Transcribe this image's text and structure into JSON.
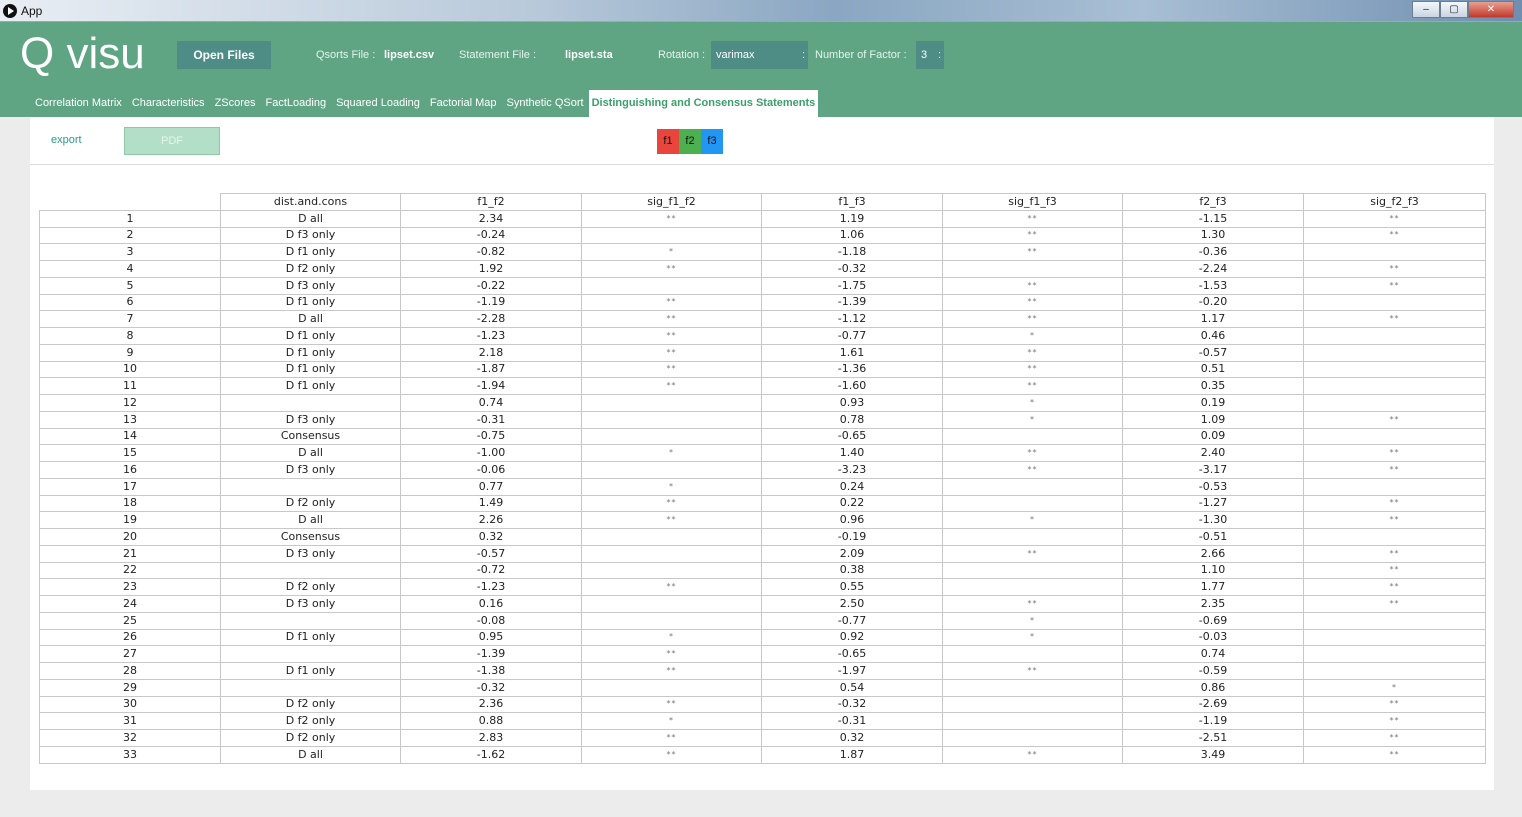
{
  "window": {
    "title": "App",
    "buttons": [
      "–",
      "▢",
      "✕"
    ]
  },
  "header": {
    "logo": "Q visu",
    "open_files": "Open Files",
    "qsorts_label": "Qsorts File :",
    "qsorts_value": "lipset.csv",
    "statement_label": "Statement File :",
    "statement_value": "lipset.sta",
    "rotation_label": "Rotation :",
    "rotation_value": "varimax",
    "nfactor_label": "Number of Factor :",
    "nfactor_value": "3",
    "select_arrow": ":"
  },
  "tabs": [
    "Correlation Matrix",
    "Characteristics",
    "ZScores",
    "FactLoading",
    "Squared Loading",
    "Factorial Map",
    "Synthetic QSort",
    "Distinguishing and Consensus Statements"
  ],
  "active_tab": 7,
  "toolbar": {
    "export": "export",
    "pdf": "PDF",
    "factors": [
      {
        "label": "f1",
        "color": "#e8453c"
      },
      {
        "label": "f2",
        "color": "#4caf50"
      },
      {
        "label": "f3",
        "color": "#2196f3"
      }
    ]
  },
  "table": {
    "columns": [
      "",
      "dist.and.cons",
      "f1_f2",
      "sig_f1_f2",
      "f1_f3",
      "sig_f1_f3",
      "f2_f3",
      "sig_f2_f3"
    ],
    "rows": [
      [
        "1",
        "D all",
        "2.34",
        "**",
        "1.19",
        "**",
        "-1.15",
        "**"
      ],
      [
        "2",
        "D f3 only",
        "-0.24",
        "",
        "1.06",
        "**",
        "1.30",
        "**"
      ],
      [
        "3",
        "D f1 only",
        "-0.82",
        "*",
        "-1.18",
        "**",
        "-0.36",
        ""
      ],
      [
        "4",
        "D f2 only",
        "1.92",
        "**",
        "-0.32",
        "",
        "-2.24",
        "**"
      ],
      [
        "5",
        "D f3 only",
        "-0.22",
        "",
        "-1.75",
        "**",
        "-1.53",
        "**"
      ],
      [
        "6",
        "D f1 only",
        "-1.19",
        "**",
        "-1.39",
        "**",
        "-0.20",
        ""
      ],
      [
        "7",
        "D all",
        "-2.28",
        "**",
        "-1.12",
        "**",
        "1.17",
        "**"
      ],
      [
        "8",
        "D f1 only",
        "-1.23",
        "**",
        "-0.77",
        "*",
        "0.46",
        ""
      ],
      [
        "9",
        "D f1 only",
        "2.18",
        "**",
        "1.61",
        "**",
        "-0.57",
        ""
      ],
      [
        "10",
        "D f1 only",
        "-1.87",
        "**",
        "-1.36",
        "**",
        "0.51",
        ""
      ],
      [
        "11",
        "D f1 only",
        "-1.94",
        "**",
        "-1.60",
        "**",
        "0.35",
        ""
      ],
      [
        "12",
        "",
        "0.74",
        "",
        "0.93",
        "*",
        "0.19",
        ""
      ],
      [
        "13",
        "D f3 only",
        "-0.31",
        "",
        "0.78",
        "*",
        "1.09",
        "**"
      ],
      [
        "14",
        "Consensus",
        "-0.75",
        "",
        "-0.65",
        "",
        "0.09",
        ""
      ],
      [
        "15",
        "D all",
        "-1.00",
        "*",
        "1.40",
        "**",
        "2.40",
        "**"
      ],
      [
        "16",
        "D f3 only",
        "-0.06",
        "",
        "-3.23",
        "**",
        "-3.17",
        "**"
      ],
      [
        "17",
        "",
        "0.77",
        "*",
        "0.24",
        "",
        "-0.53",
        ""
      ],
      [
        "18",
        "D f2 only",
        "1.49",
        "**",
        "0.22",
        "",
        "-1.27",
        "**"
      ],
      [
        "19",
        "D all",
        "2.26",
        "**",
        "0.96",
        "*",
        "-1.30",
        "**"
      ],
      [
        "20",
        "Consensus",
        "0.32",
        "",
        "-0.19",
        "",
        "-0.51",
        ""
      ],
      [
        "21",
        "D f3 only",
        "-0.57",
        "",
        "2.09",
        "**",
        "2.66",
        "**"
      ],
      [
        "22",
        "",
        "-0.72",
        "",
        "0.38",
        "",
        "1.10",
        "**"
      ],
      [
        "23",
        "D f2 only",
        "-1.23",
        "**",
        "0.55",
        "",
        "1.77",
        "**"
      ],
      [
        "24",
        "D f3 only",
        "0.16",
        "",
        "2.50",
        "**",
        "2.35",
        "**"
      ],
      [
        "25",
        "",
        "-0.08",
        "",
        "-0.77",
        "*",
        "-0.69",
        ""
      ],
      [
        "26",
        "D f1 only",
        "0.95",
        "*",
        "0.92",
        "*",
        "-0.03",
        ""
      ],
      [
        "27",
        "",
        "-1.39",
        "**",
        "-0.65",
        "",
        "0.74",
        ""
      ],
      [
        "28",
        "D f1 only",
        "-1.38",
        "**",
        "-1.97",
        "**",
        "-0.59",
        ""
      ],
      [
        "29",
        "",
        "-0.32",
        "",
        "0.54",
        "",
        "0.86",
        "*"
      ],
      [
        "30",
        "D f2 only",
        "2.36",
        "**",
        "-0.32",
        "",
        "-2.69",
        "**"
      ],
      [
        "31",
        "D f2 only",
        "0.88",
        "*",
        "-0.31",
        "",
        "-1.19",
        "**"
      ],
      [
        "32",
        "D f2 only",
        "2.83",
        "**",
        "0.32",
        "",
        "-2.51",
        "**"
      ],
      [
        "33",
        "D all",
        "-1.62",
        "**",
        "1.87",
        "**",
        "3.49",
        "**"
      ]
    ]
  }
}
